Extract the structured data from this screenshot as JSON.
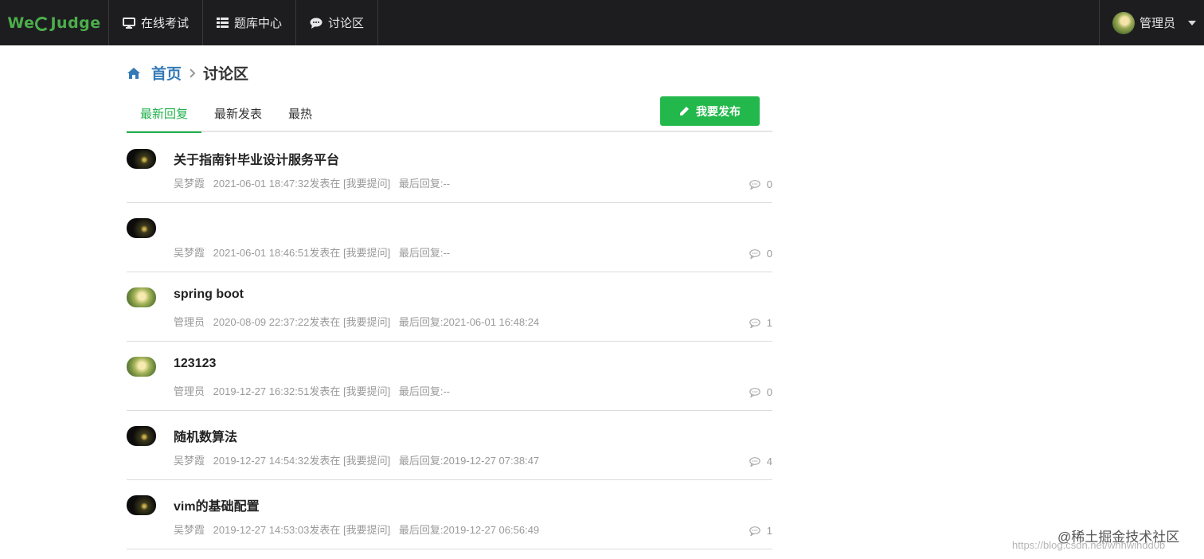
{
  "colors": {
    "accent": "#22b84b",
    "link": "#337ab7",
    "navbar": "#1d1d1f"
  },
  "navbar": {
    "brand": {
      "prefix": "We",
      "suffix": "Judge"
    },
    "items": [
      {
        "label": "在线考试",
        "icon": "monitor-icon"
      },
      {
        "label": "题库中心",
        "icon": "list-icon"
      },
      {
        "label": "讨论区",
        "icon": "chat-icon"
      }
    ],
    "user": {
      "name": "管理员",
      "icon": "caret-down-icon"
    }
  },
  "breadcrumb": {
    "home": "首页",
    "current": "讨论区",
    "icon": "home-icon"
  },
  "tabs": [
    {
      "label": "最新回复",
      "active": true
    },
    {
      "label": "最新发表",
      "active": false
    },
    {
      "label": "最热",
      "active": false
    }
  ],
  "publish_button": {
    "label": "我要发布",
    "icon": "pencil-icon"
  },
  "threads": [
    {
      "title": "关于指南针毕业设计服务平台",
      "author": "吴梦霞",
      "posted": "2021-06-01 18:47:32发表在 [我要提问]",
      "last_reply": "最后回复:--",
      "comments": "0",
      "avatar": "dark"
    },
    {
      "title": "",
      "author": "吴梦霞",
      "posted": "2021-06-01 18:46:51发表在 [我要提问]",
      "last_reply": "最后回复:--",
      "comments": "0",
      "avatar": "dark"
    },
    {
      "title": "spring boot",
      "author": "管理员",
      "posted": "2020-08-09 22:37:22发表在 [我要提问]",
      "last_reply": "最后回复:2021-06-01 16:48:24",
      "comments": "1",
      "avatar": "green"
    },
    {
      "title": "123123",
      "author": "管理员",
      "posted": "2019-12-27 16:32:51发表在 [我要提问]",
      "last_reply": "最后回复:--",
      "comments": "0",
      "avatar": "green"
    },
    {
      "title": "随机数算法",
      "author": "吴梦霞",
      "posted": "2019-12-27 14:54:32发表在 [我要提问]",
      "last_reply": "最后回复:2019-12-27 07:38:47",
      "comments": "4",
      "avatar": "dark"
    },
    {
      "title": "vim的基础配置",
      "author": "吴梦霞",
      "posted": "2019-12-27 14:53:03发表在 [我要提问]",
      "last_reply": "最后回复:2019-12-27 06:56:49",
      "comments": "1",
      "avatar": "dark"
    }
  ],
  "watermark": {
    "text": "@稀土掘金技术社区",
    "url": "https://blog.csdn.net/whhwindd0b"
  }
}
